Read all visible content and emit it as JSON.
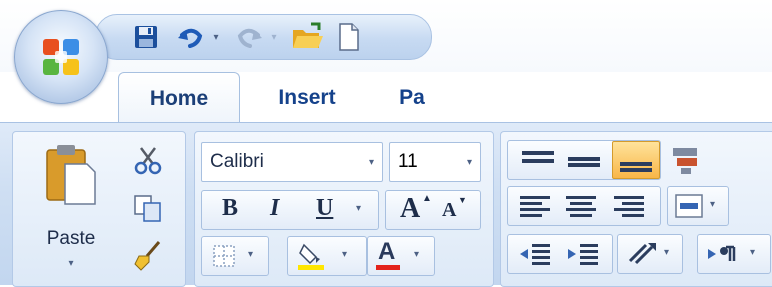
{
  "tabs": [
    {
      "label": "Home"
    },
    {
      "label": "Insert"
    },
    {
      "label": "Pa"
    }
  ],
  "clipboard": {
    "paste_label": "Paste"
  },
  "font": {
    "font_name": "Calibri",
    "font_size": "11",
    "bold_label": "B",
    "italic_label": "I",
    "underline_label": "U",
    "grow_label": "A",
    "shrink_label": "A",
    "font_color_label": "A"
  },
  "colors": {
    "tab_text": "#15428b",
    "highlight_yellow": "#ffe600",
    "font_color_red": "#e3231b",
    "selected_button": "#f8c24b"
  }
}
